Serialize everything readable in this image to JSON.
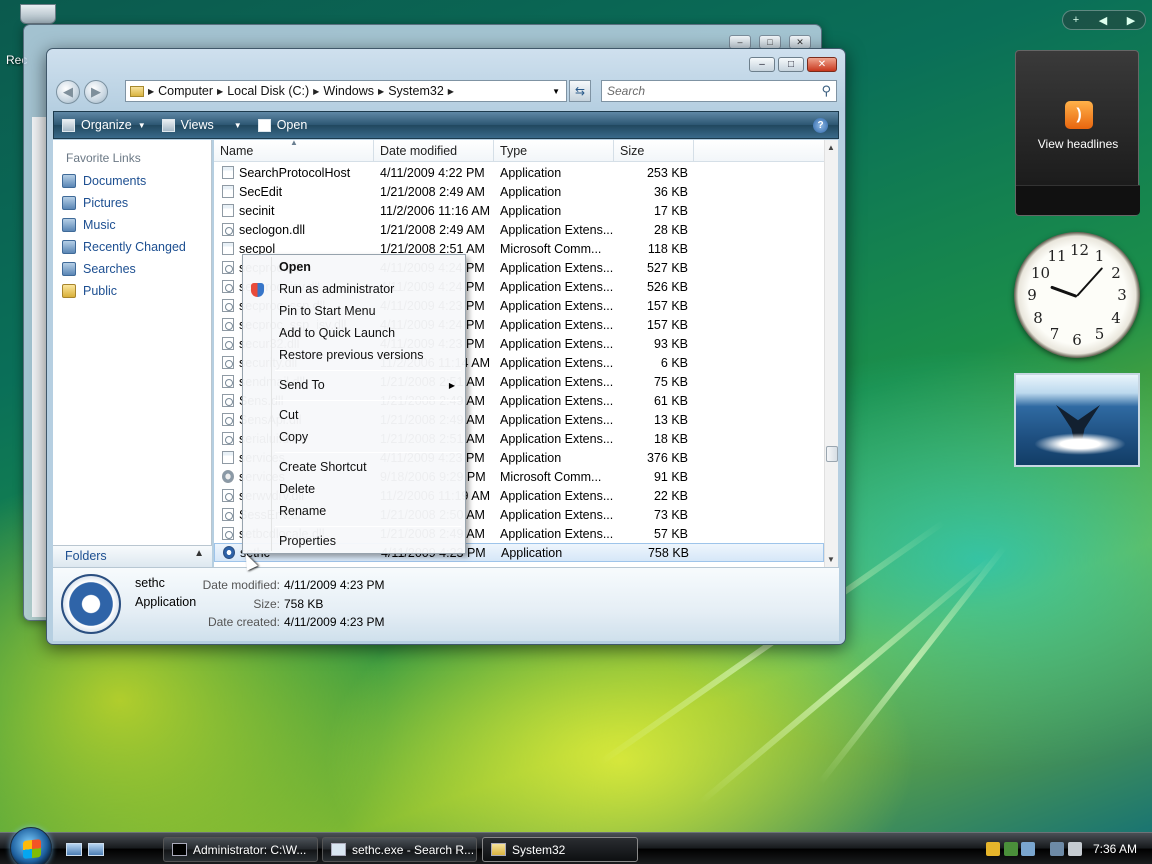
{
  "desktop": {
    "recycle_label": "Rec"
  },
  "address_bar": {
    "segments": [
      "Computer",
      "Local Disk (C:)",
      "Windows",
      "System32"
    ],
    "search_placeholder": "Search"
  },
  "command_bar": {
    "organize": "Organize",
    "views": "Views",
    "open": "Open"
  },
  "nav_pane": {
    "title": "Favorite Links",
    "items": [
      "Documents",
      "Pictures",
      "Music",
      "Recently Changed",
      "Searches",
      "Public"
    ],
    "folders": "Folders"
  },
  "columns": [
    "Name",
    "Date modified",
    "Type",
    "Size"
  ],
  "files": [
    {
      "name": "SearchProtocolHost",
      "date": "4/11/2009 4:22 PM",
      "type": "Application",
      "size": "253 KB",
      "icon": "app"
    },
    {
      "name": "SecEdit",
      "date": "1/21/2008 2:49 AM",
      "type": "Application",
      "size": "36 KB",
      "icon": "app"
    },
    {
      "name": "secinit",
      "date": "11/2/2006 11:16 AM",
      "type": "Application",
      "size": "17 KB",
      "icon": "app"
    },
    {
      "name": "seclogon.dll",
      "date": "1/21/2008 2:49 AM",
      "type": "Application Extens...",
      "size": "28 KB",
      "icon": "dll"
    },
    {
      "name": "secpol",
      "date": "1/21/2008 2:51 AM",
      "type": "Microsoft Comm...",
      "size": "118 KB",
      "icon": "app"
    },
    {
      "name": "secproc.dll",
      "date": "4/11/2009 4:24 PM",
      "type": "Application Extens...",
      "size": "527 KB",
      "icon": "dll"
    },
    {
      "name": "secproc_isv.dll",
      "date": "4/11/2009 4:24 PM",
      "type": "Application Extens...",
      "size": "526 KB",
      "icon": "dll"
    },
    {
      "name": "secproc_ssp.dll",
      "date": "4/11/2009 4:23 PM",
      "type": "Application Extens...",
      "size": "157 KB",
      "icon": "dll"
    },
    {
      "name": "secproc_ssp_isv.dll",
      "date": "4/11/2009 4:24 PM",
      "type": "Application Extens...",
      "size": "157 KB",
      "icon": "dll"
    },
    {
      "name": "secur32.dll",
      "date": "4/11/2009 4:23 PM",
      "type": "Application Extens...",
      "size": "93 KB",
      "icon": "dll"
    },
    {
      "name": "security.dll",
      "date": "11/2/2006 11:14 AM",
      "type": "Application Extens...",
      "size": "6 KB",
      "icon": "dll"
    },
    {
      "name": "sendmail.dll",
      "date": "1/21/2008 2:51 AM",
      "type": "Application Extens...",
      "size": "75 KB",
      "icon": "dll"
    },
    {
      "name": "Sens.dll",
      "date": "1/21/2008 2:49 AM",
      "type": "Application Extens...",
      "size": "61 KB",
      "icon": "dll"
    },
    {
      "name": "SensApi.dll",
      "date": "1/21/2008 2:49 AM",
      "type": "Application Extens...",
      "size": "13 KB",
      "icon": "dll"
    },
    {
      "name": "serialui.dll",
      "date": "1/21/2008 2:51 AM",
      "type": "Application Extens...",
      "size": "18 KB",
      "icon": "dll"
    },
    {
      "name": "services",
      "date": "4/11/2009 4:23 PM",
      "type": "Application",
      "size": "376 KB",
      "icon": "app"
    },
    {
      "name": "services",
      "date": "9/18/2006 9:29 PM",
      "type": "Microsoft Comm...",
      "size": "91 KB",
      "icon": "gear"
    },
    {
      "name": "serwvdrv.dll",
      "date": "11/2/2006 11:19 AM",
      "type": "Application Extens...",
      "size": "22 KB",
      "icon": "dll"
    },
    {
      "name": "SessEnv.dll",
      "date": "1/21/2008 2:50 AM",
      "type": "Application Extens...",
      "size": "73 KB",
      "icon": "dll"
    },
    {
      "name": "setbcdlocale.dll",
      "date": "1/21/2008 2:49 AM",
      "type": "Application Extens...",
      "size": "57 KB",
      "icon": "dll"
    },
    {
      "name": "sethc",
      "date": "4/11/2009 4:23 PM",
      "type": "Application",
      "size": "758 KB",
      "icon": "sethc",
      "selected": true
    }
  ],
  "context_menu": {
    "items": [
      "Open",
      "Run as administrator",
      "Pin to Start Menu",
      "Add to Quick Launch",
      "Restore previous versions",
      "Send To",
      "Cut",
      "Copy",
      "Create Shortcut",
      "Delete",
      "Rename",
      "Properties"
    ]
  },
  "details": {
    "name": "sethc",
    "type": "Application",
    "modified_label": "Date modified:",
    "modified": "4/11/2009 4:23 PM",
    "size_label": "Size:",
    "size": "758 KB",
    "created_label": "Date created:",
    "created": "4/11/2009 4:23 PM"
  },
  "gadgets": {
    "feed_label": "View headlines",
    "clock_numbers": [
      "12",
      "1",
      "2",
      "3",
      "4",
      "5",
      "6",
      "7",
      "8",
      "9",
      "10",
      "11"
    ]
  },
  "taskbar": {
    "tasks": [
      "Administrator: C:\\W...",
      "sethc.exe - Search R...",
      "System32"
    ],
    "time": "7:36 AM"
  }
}
